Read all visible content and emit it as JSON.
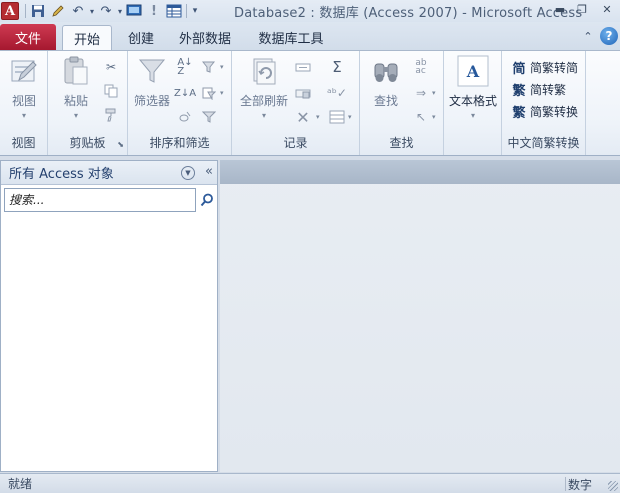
{
  "titlebar": {
    "title": "Database2 : 数据库 (Access 2007)  -  Microsoft Access",
    "app_icon_letter": "A"
  },
  "tabs": {
    "file": "文件",
    "items": [
      "开始",
      "创建",
      "外部数据",
      "数据库工具"
    ]
  },
  "ribbon": {
    "view_group": {
      "button": "视图",
      "label": "视图"
    },
    "clipboard_group": {
      "button": "粘贴",
      "label": "剪贴板"
    },
    "sort_group": {
      "button": "筛选器",
      "label": "排序和筛选"
    },
    "records_group": {
      "button": "全部刷新",
      "label": "记录"
    },
    "find_group": {
      "button": "查找",
      "label": "查找"
    },
    "text_group": {
      "button": "文本格式"
    },
    "chinese_group": {
      "items": [
        "简繁转简",
        "简转繁",
        "简繁转换"
      ],
      "icons": [
        "简",
        "繁",
        "繁"
      ],
      "label": "中文简繁转换"
    }
  },
  "nav": {
    "title": "所有 Access 对象",
    "search_placeholder": "搜索..."
  },
  "status": {
    "left": "就绪",
    "right": "数字"
  },
  "colors": {
    "file_tab": "#b82036",
    "ribbon_bg": "#f3f6fb",
    "workspace": "#e6ebf1"
  }
}
